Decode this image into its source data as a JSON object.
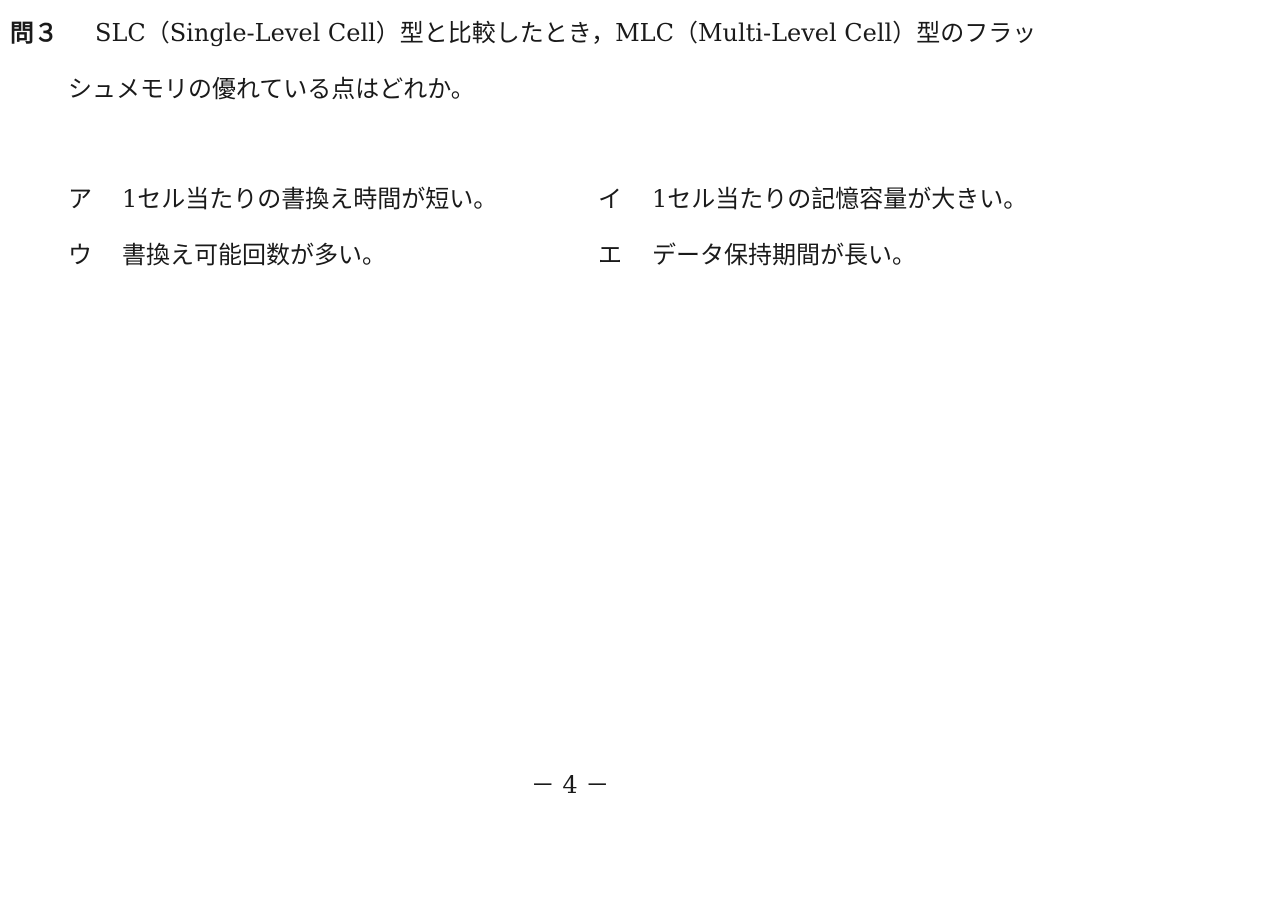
{
  "question": {
    "number": "問３",
    "line1": "SLC（Single-Level Cell）型と比較したとき，MLC（Multi-Level Cell）型のフラッ",
    "line2": "シュメモリの優れている点はどれか。"
  },
  "choices": [
    {
      "letter": "ア",
      "text": "1セル当たりの書換え時間が短い。"
    },
    {
      "letter": "イ",
      "text": "1セル当たりの記憶容量が大きい。"
    },
    {
      "letter": "ウ",
      "text": "書換え可能回数が多い。"
    },
    {
      "letter": "エ",
      "text": "データ保持期間が長い。"
    }
  ],
  "footer": {
    "page_number": "－ 4 －"
  }
}
